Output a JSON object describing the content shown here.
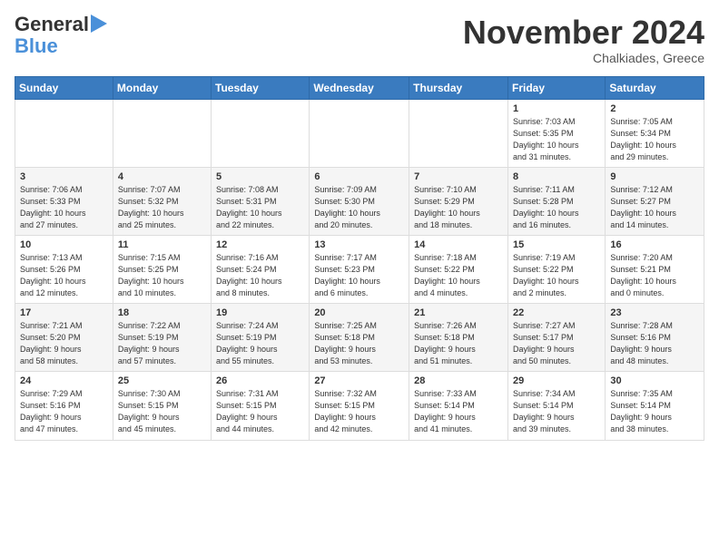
{
  "header": {
    "logo_general": "General",
    "logo_blue": "Blue",
    "month_title": "November 2024",
    "subtitle": "Chalkiades, Greece"
  },
  "weekdays": [
    "Sunday",
    "Monday",
    "Tuesday",
    "Wednesday",
    "Thursday",
    "Friday",
    "Saturday"
  ],
  "weeks": [
    [
      {
        "day": "",
        "info": ""
      },
      {
        "day": "",
        "info": ""
      },
      {
        "day": "",
        "info": ""
      },
      {
        "day": "",
        "info": ""
      },
      {
        "day": "",
        "info": ""
      },
      {
        "day": "1",
        "info": "Sunrise: 7:03 AM\nSunset: 5:35 PM\nDaylight: 10 hours\nand 31 minutes."
      },
      {
        "day": "2",
        "info": "Sunrise: 7:05 AM\nSunset: 5:34 PM\nDaylight: 10 hours\nand 29 minutes."
      }
    ],
    [
      {
        "day": "3",
        "info": "Sunrise: 7:06 AM\nSunset: 5:33 PM\nDaylight: 10 hours\nand 27 minutes."
      },
      {
        "day": "4",
        "info": "Sunrise: 7:07 AM\nSunset: 5:32 PM\nDaylight: 10 hours\nand 25 minutes."
      },
      {
        "day": "5",
        "info": "Sunrise: 7:08 AM\nSunset: 5:31 PM\nDaylight: 10 hours\nand 22 minutes."
      },
      {
        "day": "6",
        "info": "Sunrise: 7:09 AM\nSunset: 5:30 PM\nDaylight: 10 hours\nand 20 minutes."
      },
      {
        "day": "7",
        "info": "Sunrise: 7:10 AM\nSunset: 5:29 PM\nDaylight: 10 hours\nand 18 minutes."
      },
      {
        "day": "8",
        "info": "Sunrise: 7:11 AM\nSunset: 5:28 PM\nDaylight: 10 hours\nand 16 minutes."
      },
      {
        "day": "9",
        "info": "Sunrise: 7:12 AM\nSunset: 5:27 PM\nDaylight: 10 hours\nand 14 minutes."
      }
    ],
    [
      {
        "day": "10",
        "info": "Sunrise: 7:13 AM\nSunset: 5:26 PM\nDaylight: 10 hours\nand 12 minutes."
      },
      {
        "day": "11",
        "info": "Sunrise: 7:15 AM\nSunset: 5:25 PM\nDaylight: 10 hours\nand 10 minutes."
      },
      {
        "day": "12",
        "info": "Sunrise: 7:16 AM\nSunset: 5:24 PM\nDaylight: 10 hours\nand 8 minutes."
      },
      {
        "day": "13",
        "info": "Sunrise: 7:17 AM\nSunset: 5:23 PM\nDaylight: 10 hours\nand 6 minutes."
      },
      {
        "day": "14",
        "info": "Sunrise: 7:18 AM\nSunset: 5:22 PM\nDaylight: 10 hours\nand 4 minutes."
      },
      {
        "day": "15",
        "info": "Sunrise: 7:19 AM\nSunset: 5:22 PM\nDaylight: 10 hours\nand 2 minutes."
      },
      {
        "day": "16",
        "info": "Sunrise: 7:20 AM\nSunset: 5:21 PM\nDaylight: 10 hours\nand 0 minutes."
      }
    ],
    [
      {
        "day": "17",
        "info": "Sunrise: 7:21 AM\nSunset: 5:20 PM\nDaylight: 9 hours\nand 58 minutes."
      },
      {
        "day": "18",
        "info": "Sunrise: 7:22 AM\nSunset: 5:19 PM\nDaylight: 9 hours\nand 57 minutes."
      },
      {
        "day": "19",
        "info": "Sunrise: 7:24 AM\nSunset: 5:19 PM\nDaylight: 9 hours\nand 55 minutes."
      },
      {
        "day": "20",
        "info": "Sunrise: 7:25 AM\nSunset: 5:18 PM\nDaylight: 9 hours\nand 53 minutes."
      },
      {
        "day": "21",
        "info": "Sunrise: 7:26 AM\nSunset: 5:18 PM\nDaylight: 9 hours\nand 51 minutes."
      },
      {
        "day": "22",
        "info": "Sunrise: 7:27 AM\nSunset: 5:17 PM\nDaylight: 9 hours\nand 50 minutes."
      },
      {
        "day": "23",
        "info": "Sunrise: 7:28 AM\nSunset: 5:16 PM\nDaylight: 9 hours\nand 48 minutes."
      }
    ],
    [
      {
        "day": "24",
        "info": "Sunrise: 7:29 AM\nSunset: 5:16 PM\nDaylight: 9 hours\nand 47 minutes."
      },
      {
        "day": "25",
        "info": "Sunrise: 7:30 AM\nSunset: 5:15 PM\nDaylight: 9 hours\nand 45 minutes."
      },
      {
        "day": "26",
        "info": "Sunrise: 7:31 AM\nSunset: 5:15 PM\nDaylight: 9 hours\nand 44 minutes."
      },
      {
        "day": "27",
        "info": "Sunrise: 7:32 AM\nSunset: 5:15 PM\nDaylight: 9 hours\nand 42 minutes."
      },
      {
        "day": "28",
        "info": "Sunrise: 7:33 AM\nSunset: 5:14 PM\nDaylight: 9 hours\nand 41 minutes."
      },
      {
        "day": "29",
        "info": "Sunrise: 7:34 AM\nSunset: 5:14 PM\nDaylight: 9 hours\nand 39 minutes."
      },
      {
        "day": "30",
        "info": "Sunrise: 7:35 AM\nSunset: 5:14 PM\nDaylight: 9 hours\nand 38 minutes."
      }
    ]
  ]
}
